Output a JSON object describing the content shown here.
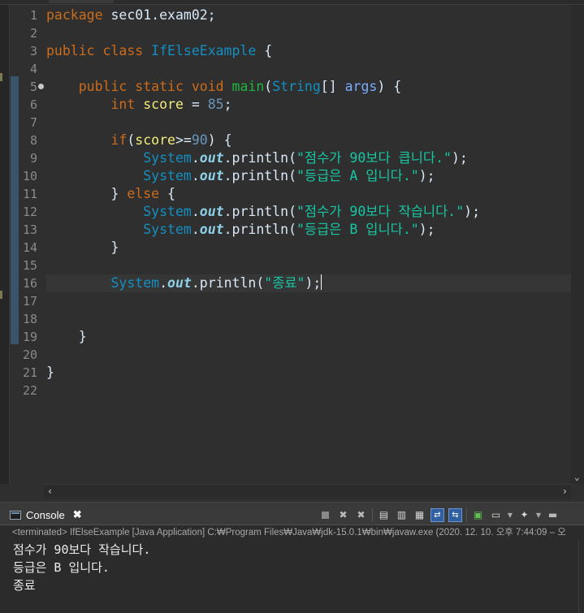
{
  "editor": {
    "line_numbers": [
      "1",
      "2",
      "3",
      "4",
      "5",
      "6",
      "7",
      "8",
      "9",
      "10",
      "11",
      "12",
      "13",
      "14",
      "15",
      "16",
      "17",
      "18",
      "19",
      "20",
      "21",
      "22"
    ],
    "code": {
      "l1_kw": "package",
      "l1_rest": " sec01.exam02;",
      "l3_public": "public",
      "l3_class": " class ",
      "l3_name": "IfElseExample",
      "l3_brace": " {",
      "l5_indent": "    ",
      "l5_public": "public",
      "l5_static": " static",
      "l5_void": " void",
      "l5_main": " main",
      "l5_open": "(",
      "l5_string": "String",
      "l5_arr": "[] ",
      "l5_args": "args",
      "l5_close": ") {",
      "l6_indent": "        ",
      "l6_int": "int",
      "l6_score": " score",
      "l6_eq": " = ",
      "l6_num": "85",
      "l6_semi": ";",
      "l8_indent": "        ",
      "l8_if": "if",
      "l8_open": "(",
      "l8_score": "score",
      "l8_op": ">=",
      "l8_num": "90",
      "l8_close": ") {",
      "sys_indent": "            ",
      "system": "System",
      "dot1": ".",
      "out": "out",
      "dot2": ".",
      "println": "println",
      "popen": "(",
      "pclose": ");",
      "l9_str": "\"점수가 90보다 큽니다.\"",
      "l10_str": "\"등급은 A 입니다.\"",
      "l11_indent": "        ",
      "l11_rb": "} ",
      "l11_else": "else",
      "l11_lb": " {",
      "l12_str": "\"점수가 90보다 작습니다.\"",
      "l13_str": "\"등급은 B 입니다.\"",
      "l14_indent": "        ",
      "l14_rb": "}",
      "l16_indent": "        ",
      "l16_str": "\"종료\"",
      "l19_indent": "    ",
      "l19_rb": "}",
      "l21_rb": "}"
    }
  },
  "console": {
    "tab_label": "Console",
    "tab_close": "✖",
    "description": "<terminated> IfElseExample [Java Application] C:₩Program Files₩Java₩jdk-15.0.1₩bin₩javaw.exe  (2020. 12. 10. 오후 7:44:09 – 오",
    "output": [
      "점수가 90보다 작습니다.",
      "등급은 B 입니다.",
      "종료"
    ]
  },
  "colors": {
    "editor_bg": "#2f2f2f",
    "keyword": "#cc6c1d",
    "type": "#1290c3",
    "method": "#1eb540",
    "variable": "#f3ec79",
    "parameter": "#79abff",
    "string": "#17c6a3",
    "static_field": "#8dd1e8"
  },
  "icons": [
    "terminate-icon",
    "remove-launch-icon",
    "remove-all-launches-icon",
    "clear-console-icon",
    "scroll-lock-icon",
    "word-wrap-icon",
    "pin-console-icon",
    "show-on-output-icon",
    "display-selected-console-icon",
    "open-console-icon",
    "minimize-icon",
    "maximize-icon"
  ]
}
